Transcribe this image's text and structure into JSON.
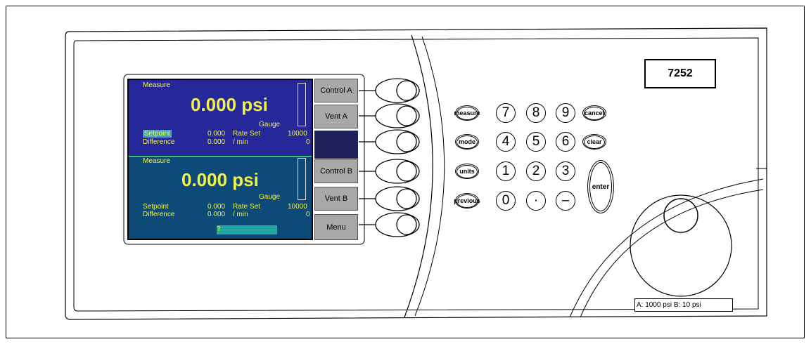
{
  "model": "7252",
  "range_label": "A: 1000 psi B: 10 psi",
  "channel_a": {
    "title": "Measure",
    "reading": "0.000 psi",
    "mode": "Gauge",
    "setpoint_label": "Setpoint",
    "setpoint_value": "0.000",
    "rate_label": "Rate Set",
    "rate_value": "10000",
    "difference_label": "Difference",
    "difference_value": "0.000",
    "per_min": "/ min",
    "difference_count": "0"
  },
  "channel_b": {
    "title": "Measure",
    "reading": "0.000 psi",
    "mode": "Gauge",
    "setpoint_label": "Setpoint",
    "setpoint_value": "0.000",
    "rate_label": "Rate Set",
    "rate_value": "10000",
    "difference_label": "Difference",
    "difference_value": "0.000",
    "per_min": "/ min",
    "difference_count": "0",
    "prompt": "?"
  },
  "softkeys": {
    "k1": "Control A",
    "k2": "Vent A",
    "k4": "Control B",
    "k5": "Vent B",
    "k6": "Menu"
  },
  "keypad": {
    "measure": "measure",
    "mode": "mode",
    "units": "units",
    "previous": "previous",
    "cancel": "cancel",
    "clear": "clear",
    "enter": "enter",
    "n7": "7",
    "n8": "8",
    "n9": "9",
    "n4": "4",
    "n5": "5",
    "n6": "6",
    "n1": "1",
    "n2": "2",
    "n3": "3",
    "n0": "0",
    "dot": "·",
    "minus": "–"
  },
  "colors": {
    "screen_top": "#26289a",
    "screen_bottom": "#0e4a78",
    "screen_text": "#f2f24a",
    "softkey": "#a8a8a8"
  }
}
